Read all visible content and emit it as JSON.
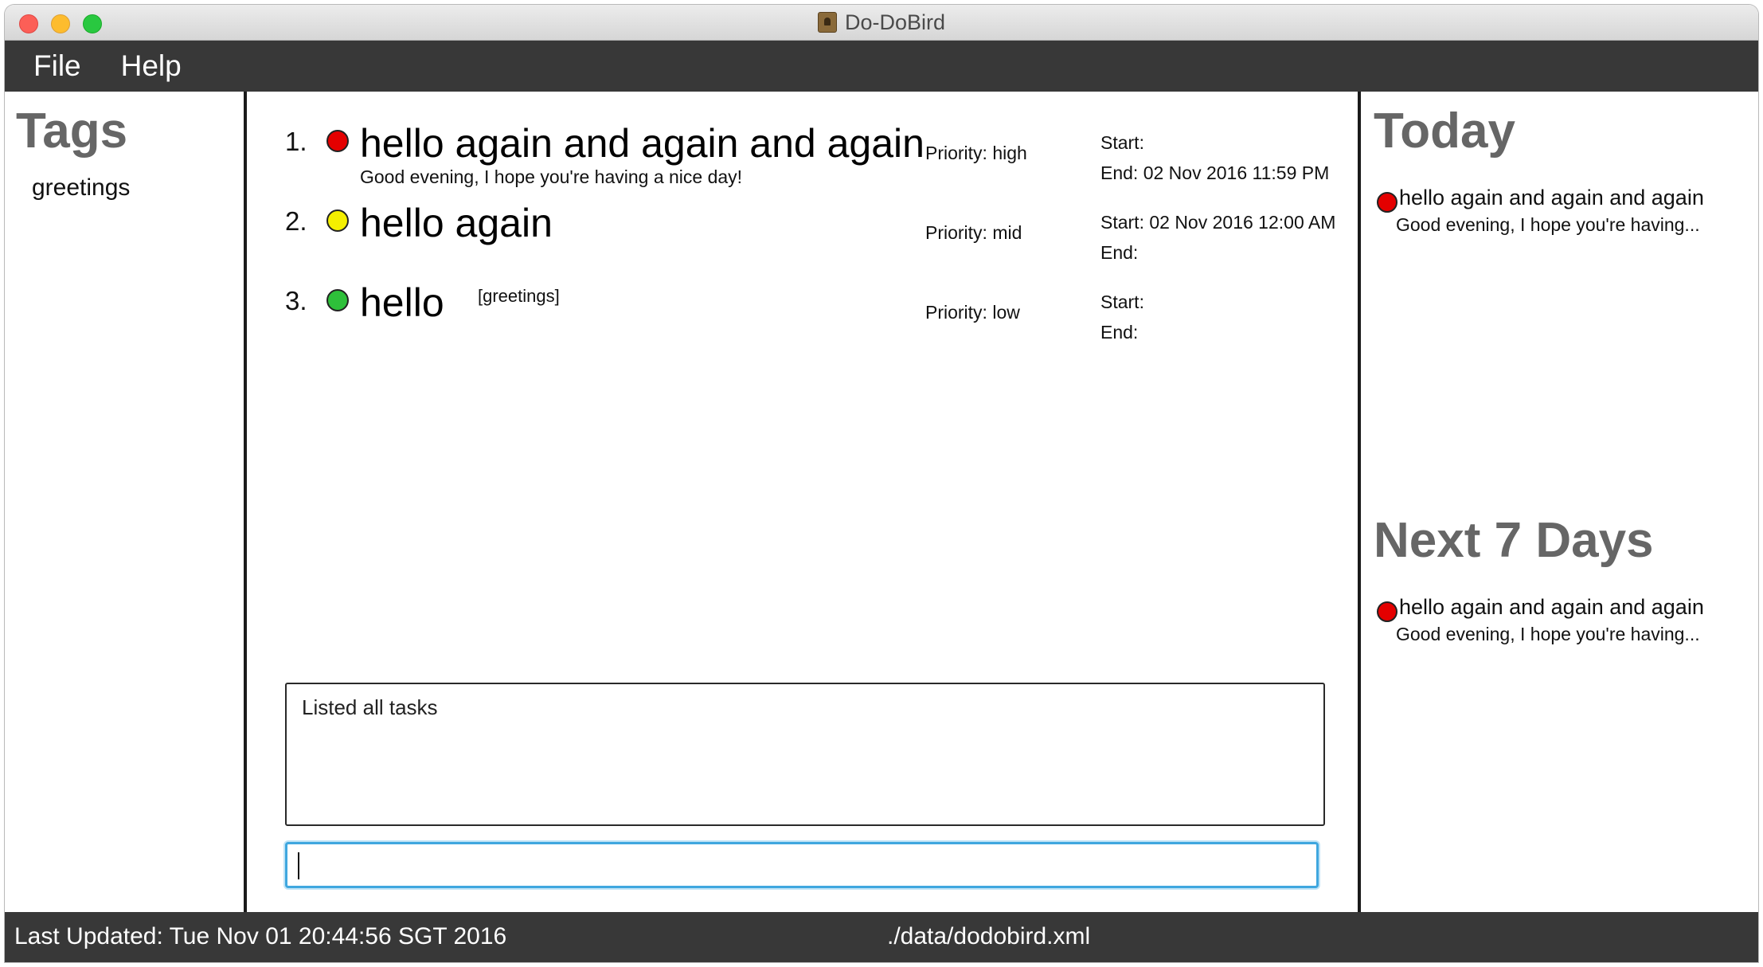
{
  "window": {
    "title": "Do-DoBird"
  },
  "menu": {
    "file": "File",
    "help": "Help"
  },
  "tags_panel": {
    "heading": "Tags",
    "items": [
      "greetings"
    ]
  },
  "tasks": [
    {
      "index": "1.",
      "priority_level": "high",
      "dot_color": "#e40000",
      "name": "hello again and again and again",
      "description": "Good evening, I hope you're having a nice day!",
      "tags": "",
      "priority": "Priority: high",
      "start": "Start:",
      "end": "End: 02 Nov 2016 11:59 PM"
    },
    {
      "index": "2.",
      "priority_level": "mid",
      "dot_color": "#f4ef00",
      "name": "hello again",
      "description": "",
      "tags": "",
      "priority": "Priority: mid",
      "start": "Start: 02 Nov 2016 12:00 AM",
      "end": "End:"
    },
    {
      "index": "3.",
      "priority_level": "low",
      "dot_color": "#2ec03a",
      "name": "hello",
      "description": "",
      "tags": "[greetings]",
      "priority": "Priority: low",
      "start": "Start:",
      "end": "End:"
    }
  ],
  "result_display": {
    "text": "Listed all tasks"
  },
  "command_box": {
    "value": "",
    "placeholder": ""
  },
  "today": {
    "heading": "Today",
    "items": [
      {
        "name": "hello again and again and again",
        "description": "Good evening, I hope you're having..."
      }
    ]
  },
  "next7": {
    "heading": "Next 7 Days",
    "items": [
      {
        "name": "hello again and again and again",
        "description": "Good evening, I hope you're having..."
      }
    ]
  },
  "statusbar": {
    "last_updated": "Last Updated: Tue Nov 01 20:44:56 SGT 2016",
    "file_path": "./data/dodobird.xml"
  },
  "colors": {
    "accent": "#3fa7df",
    "bar": "#383838",
    "heading": "#666666"
  }
}
